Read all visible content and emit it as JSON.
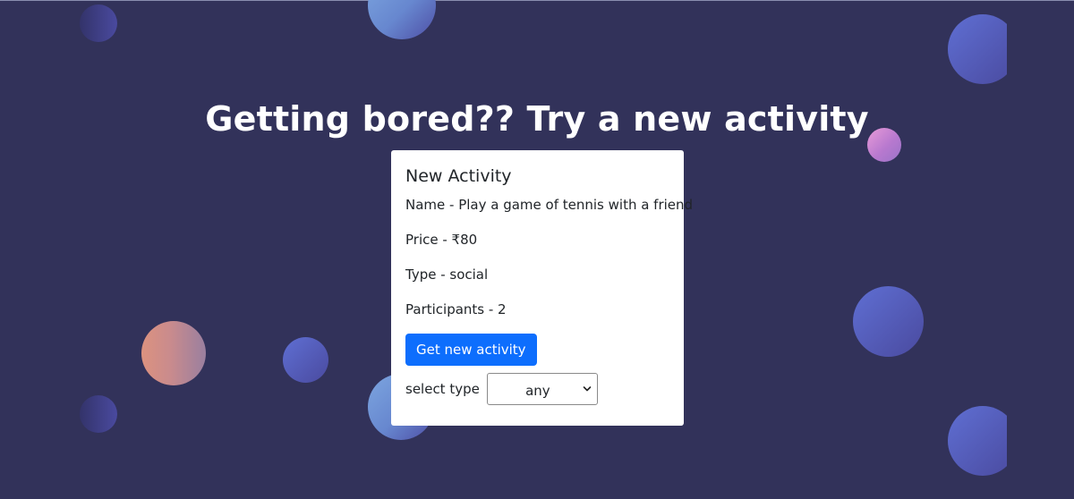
{
  "page": {
    "heading": "Getting bored?? Try a new activity"
  },
  "card": {
    "title": "New Activity",
    "name_line": "Name - Play a game of tennis with a friend",
    "price_line": "Price - ₹80",
    "type_line": "Type - social",
    "participants_line": "Participants - 2",
    "button_label": "Get new activity",
    "select_label": "select type",
    "select_value": "any"
  },
  "colors": {
    "background": "#32325a",
    "card": "#ffffff",
    "button": "#0d6efd",
    "button_text": "#ffffff",
    "heading_text": "#ffffff"
  },
  "icons": {
    "select_chevron": "chevron-down-icon"
  }
}
